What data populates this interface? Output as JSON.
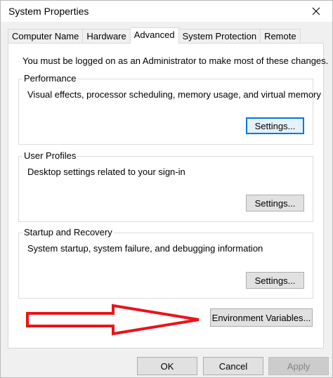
{
  "window": {
    "title": "System Properties"
  },
  "tabs": [
    {
      "label": "Computer Name"
    },
    {
      "label": "Hardware"
    },
    {
      "label": "Advanced"
    },
    {
      "label": "System Protection"
    },
    {
      "label": "Remote"
    }
  ],
  "active_tab": "Advanced",
  "admin_note": "You must be logged on as an Administrator to make most of these changes.",
  "groups": {
    "performance": {
      "legend": "Performance",
      "description": "Visual effects, processor scheduling, memory usage, and virtual memory",
      "button": "Settings..."
    },
    "user_profiles": {
      "legend": "User Profiles",
      "description": "Desktop settings related to your sign-in",
      "button": "Settings..."
    },
    "startup_recovery": {
      "legend": "Startup and Recovery",
      "description": "System startup, system failure, and debugging information",
      "button": "Settings..."
    }
  },
  "env_button": "Environment Variables...",
  "footer": {
    "ok": "OK",
    "cancel": "Cancel",
    "apply": "Apply"
  },
  "colors": {
    "annotation_arrow": "#e8141b",
    "focus_accent": "#0078d7"
  }
}
